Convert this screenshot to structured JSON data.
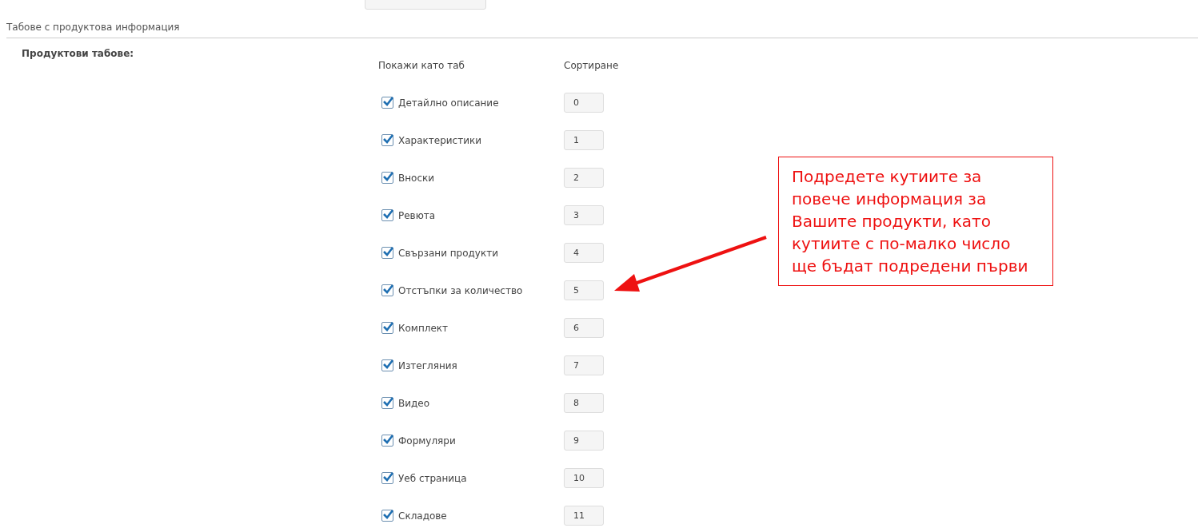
{
  "section_title": "Табове с продуктова информация",
  "field_label": "Продуктови табове:",
  "columns": [
    "Покажи като таб",
    "Сортиране"
  ],
  "tabs": [
    {
      "label": "Детайлно описание",
      "checked": true,
      "sort": "0"
    },
    {
      "label": "Характеристики",
      "checked": true,
      "sort": "1"
    },
    {
      "label": "Вноски",
      "checked": true,
      "sort": "2"
    },
    {
      "label": "Ревюта",
      "checked": true,
      "sort": "3"
    },
    {
      "label": "Свързани продукти",
      "checked": true,
      "sort": "4"
    },
    {
      "label": "Отстъпки за количество",
      "checked": true,
      "sort": "5"
    },
    {
      "label": "Комплект",
      "checked": true,
      "sort": "6"
    },
    {
      "label": "Изтегляния",
      "checked": true,
      "sort": "7"
    },
    {
      "label": "Видео",
      "checked": true,
      "sort": "8"
    },
    {
      "label": "Формуляри",
      "checked": true,
      "sort": "9"
    },
    {
      "label": "Уеб страница",
      "checked": true,
      "sort": "10"
    },
    {
      "label": "Складове",
      "checked": true,
      "sort": "11"
    }
  ],
  "callout": "Подредете кутиите за повече информация за Вашите продукти, като кутиите с по-малко число ще бъдат подредени първи"
}
